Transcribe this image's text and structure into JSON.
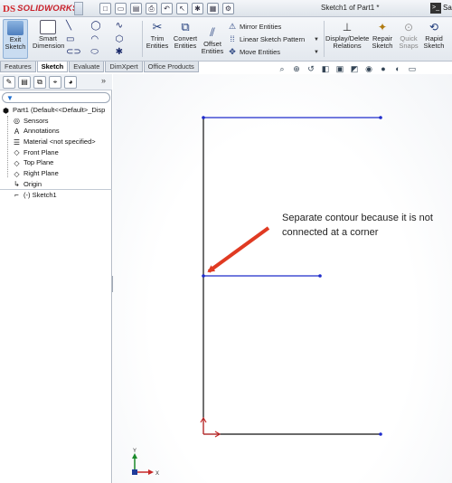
{
  "app": {
    "brand_mark": "DS",
    "brand_name": "SOLIDWORKS",
    "document_title": "Sketch1 of Part1 *",
    "cut_text": "Sa"
  },
  "quick_access": [
    {
      "name": "new-icon",
      "glyph": "□"
    },
    {
      "name": "open-icon",
      "glyph": "▭"
    },
    {
      "name": "save-icon",
      "glyph": "▤"
    },
    {
      "name": "print-icon",
      "glyph": "⎙"
    },
    {
      "name": "undo-icon",
      "glyph": "↶"
    },
    {
      "name": "select-icon",
      "glyph": "↖"
    },
    {
      "name": "rebuild-icon",
      "glyph": "✱"
    },
    {
      "name": "file-properties-icon",
      "glyph": "▦"
    },
    {
      "name": "options-icon",
      "glyph": "⚙"
    }
  ],
  "ribbon": {
    "exit_sketch": "Exit Sketch",
    "smart_dimension": "Smart Dimension",
    "sketch_tools": [
      {
        "name": "line-tool",
        "glyph": "╲"
      },
      {
        "name": "circle-tool",
        "glyph": "◯"
      },
      {
        "name": "spline-tool",
        "glyph": "∿"
      },
      {
        "name": "rectangle-tool",
        "glyph": "▭"
      },
      {
        "name": "arc-tool",
        "glyph": "◠"
      },
      {
        "name": "polygon-tool",
        "glyph": "⬡"
      },
      {
        "name": "slot-tool",
        "glyph": "⊂⊃"
      },
      {
        "name": "ellipse-tool",
        "glyph": "⬭"
      },
      {
        "name": "point-tool",
        "glyph": "✱"
      }
    ],
    "trim_entities": "Trim Entities",
    "convert_entities": "Convert Entities",
    "offset_entities": "Offset Entities",
    "mirror_entities": "Mirror Entities",
    "linear_sketch_pattern": "Linear Sketch Pattern",
    "move_entities": "Move Entities",
    "display_delete_relations": "Display/Delete Relations",
    "repair_sketch": "Repair Sketch",
    "quick_snaps": "Quick Snaps",
    "rapid_sketch": "Rapid Sketch"
  },
  "tabs": [
    "Features",
    "Sketch",
    "Evaluate",
    "DimXpert",
    "Office Products"
  ],
  "active_tab": "Sketch",
  "manager_tabs": [
    {
      "name": "featuremanager-tab-icon",
      "glyph": "✎"
    },
    {
      "name": "propertymanager-tab-icon",
      "glyph": "▤"
    },
    {
      "name": "configurationmanager-tab-icon",
      "glyph": "⧉"
    },
    {
      "name": "dimxpertmanager-tab-icon",
      "glyph": "⌖"
    },
    {
      "name": "appearance-tab-icon",
      "glyph": "◕"
    }
  ],
  "manager_more": "»",
  "tree": [
    {
      "label": "Part1  (Default<<Default>_Disp",
      "icon": "part-icon",
      "glyph": "⬢"
    },
    {
      "label": "Sensors",
      "icon": "sensors-icon",
      "glyph": "◎"
    },
    {
      "label": "Annotations",
      "icon": "annotations-icon",
      "glyph": "A"
    },
    {
      "label": "Material <not specified>",
      "icon": "material-icon",
      "glyph": "☰"
    },
    {
      "label": "Front Plane",
      "icon": "plane-icon",
      "glyph": "◇"
    },
    {
      "label": "Top Plane",
      "icon": "plane-icon",
      "glyph": "◇"
    },
    {
      "label": "Right Plane",
      "icon": "plane-icon",
      "glyph": "◇"
    },
    {
      "label": "Origin",
      "icon": "origin-icon",
      "glyph": "↳"
    },
    {
      "label": "(-) Sketch1",
      "icon": "sketch-icon",
      "glyph": "⌐"
    }
  ],
  "hud": [
    {
      "name": "zoom-to-fit-icon",
      "glyph": "⌕"
    },
    {
      "name": "zoom-area-icon",
      "glyph": "⊕"
    },
    {
      "name": "previous-view-icon",
      "glyph": "↺"
    },
    {
      "name": "section-view-icon",
      "glyph": "◧"
    },
    {
      "name": "view-orientation-icon",
      "glyph": "▣"
    },
    {
      "name": "display-style-icon",
      "glyph": "◩"
    },
    {
      "name": "hide-show-icon",
      "glyph": "◉"
    },
    {
      "name": "edit-appearance-icon",
      "glyph": "●"
    },
    {
      "name": "apply-scene-icon",
      "glyph": "◐"
    },
    {
      "name": "view-settings-icon",
      "glyph": "▭"
    }
  ],
  "annotation": {
    "text": "Separate contour because it is not connected at a corner"
  },
  "triad": {
    "y_label": "Y",
    "x_label": "X"
  },
  "colors": {
    "sketch_line": "#1f2ccb",
    "fixed_line": "#111111",
    "arrow": "#e03a22",
    "origin": "#c62828"
  }
}
